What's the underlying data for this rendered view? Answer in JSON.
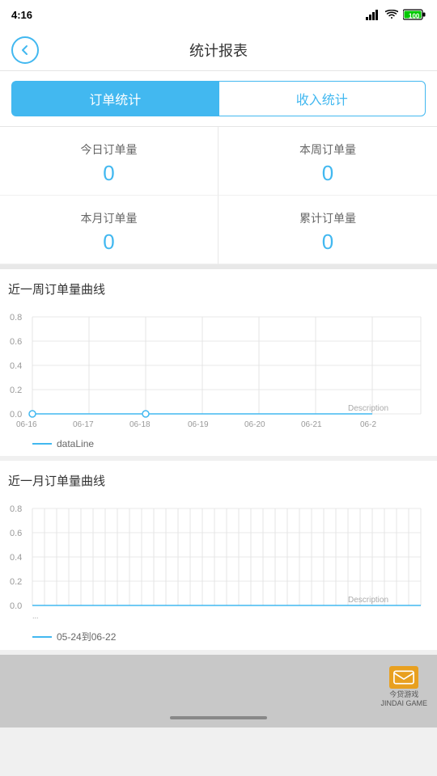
{
  "statusBar": {
    "time": "4:16",
    "icons": [
      "signal",
      "wifi",
      "battery"
    ]
  },
  "header": {
    "title": "统计报表",
    "backLabel": "back"
  },
  "tabs": [
    {
      "id": "order",
      "label": "订单统计",
      "active": true
    },
    {
      "id": "income",
      "label": "收入统计",
      "active": false
    }
  ],
  "stats": [
    {
      "label": "今日订单量",
      "value": "0"
    },
    {
      "label": "本周订单量",
      "value": "0"
    },
    {
      "label": "本月订单量",
      "value": "0"
    },
    {
      "label": "累计订单量",
      "value": "0"
    }
  ],
  "charts": [
    {
      "title": "近一周订单量曲线",
      "legend": "dataLine",
      "xLabels": [
        "06-16",
        "06-17",
        "06-18",
        "06-19",
        "06-20",
        "06-21",
        "06-2"
      ],
      "yLabels": [
        "0.8",
        "0.6",
        "0.4",
        "0.2",
        "0.0"
      ],
      "description": "Description",
      "points": [
        {
          "x": 0,
          "y": 0
        },
        {
          "x": 1,
          "y": 0
        },
        {
          "x": 2,
          "y": 0
        },
        {
          "x": 3,
          "y": 0
        },
        {
          "x": 4,
          "y": 0
        },
        {
          "x": 5,
          "y": 0
        },
        {
          "x": 6,
          "y": 0
        }
      ],
      "dotPositions": [
        {
          "xi": 0,
          "yi": 1
        },
        {
          "xi": 2,
          "yi": 1
        }
      ]
    },
    {
      "title": "近一月订单量曲线",
      "legend": "05-24到06-22",
      "yLabels": [
        "0.8",
        "0.6",
        "0.4",
        "0.2",
        "0.0"
      ],
      "description": "Description",
      "points": [],
      "dotPositions": []
    }
  ],
  "watermark": {
    "text": "今贷游戏",
    "subtext": "JINDAI GAME"
  }
}
